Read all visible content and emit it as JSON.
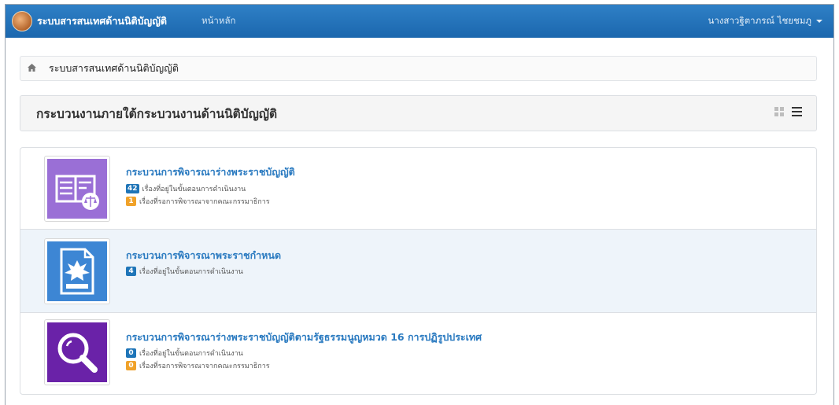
{
  "navbar": {
    "brand_title": "ระบบสารสนเทศด้านนิติบัญญัติ",
    "home_link": "หน้าหลัก",
    "user_name": "นางสาวฐิตาภรณ์ ไชยชมภู"
  },
  "breadcrumb": {
    "home_icon": "home-icon",
    "current": "ระบบสารสนเทศด้านนิติบัญญัติ"
  },
  "panel": {
    "title": "กระบวนงานภายใต้กระบวนงานด้านนิติบัญญัติ",
    "view_icons": [
      "grid-view-icon",
      "list-view-icon"
    ]
  },
  "processes": [
    {
      "title": "กระบวนการพิจารณาร่างพระราชบัญญัติ",
      "icon": "law-book-scale-icon",
      "accent": "#9a6fd6",
      "stats": [
        {
          "count": "42",
          "label": "เรื่องที่อยู่ในขั้นตอนการดำเนินงาน",
          "color": "#1f75b8"
        },
        {
          "count": "1",
          "label": "เรื่องที่รอการพิจารณาจากคณะกรรมาธิการ",
          "color": "#f0a22a"
        }
      ]
    },
    {
      "title": "กระบวนการพิจารณาพระราชกำหนด",
      "icon": "decree-document-icon",
      "accent": "#3d86d4",
      "stats": [
        {
          "count": "4",
          "label": "เรื่องที่อยู่ในขั้นตอนการดำเนินงาน",
          "color": "#1f75b8"
        }
      ]
    },
    {
      "title": "กระบวนการพิจารณาร่างพระราชบัญญัติตามรัฐธรรมนูญหมวด 16 การปฏิรูปประเทศ",
      "icon": "magnifier-icon",
      "accent": "#6a22a8",
      "stats": [
        {
          "count": "0",
          "label": "เรื่องที่อยู่ในขั้นตอนการดำเนินงาน",
          "color": "#1f75b8"
        },
        {
          "count": "0",
          "label": "เรื่องที่รอการพิจารณาจากคณะกรรมาธิการ",
          "color": "#f0a22a"
        }
      ]
    }
  ]
}
